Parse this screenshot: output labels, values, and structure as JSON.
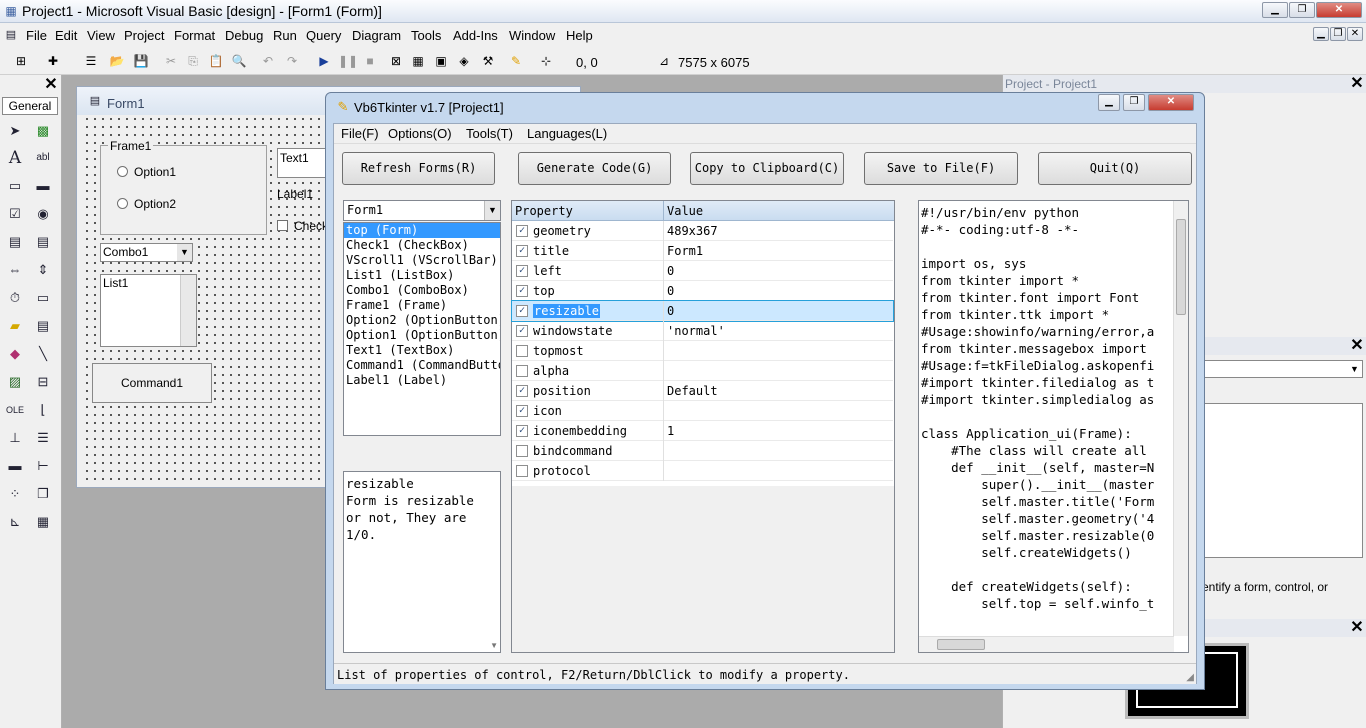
{
  "window": {
    "title": "Project1 - Microsoft Visual Basic [design] - [Form1 (Form)]"
  },
  "menu": [
    "File",
    "Edit",
    "View",
    "Project",
    "Format",
    "Debug",
    "Run",
    "Query",
    "Diagram",
    "Tools",
    "Add-Ins",
    "Window",
    "Help"
  ],
  "toolbar": {
    "position": "0, 0",
    "size": "7575 x 6075"
  },
  "toolbox": {
    "tab_label": "General",
    "close": "x"
  },
  "form_designer": {
    "title": "Form1",
    "frame_label": "Frame1",
    "option1": "Option1",
    "option2": "Option2",
    "text1": "Text1",
    "label1": "Label1",
    "check_partial": "Check",
    "combo1": "Combo1",
    "list1": "List1",
    "command1": "Command1"
  },
  "project_panel": {
    "title": "Project - Project1",
    "hint_text": "entify a form, control, or"
  },
  "vb6tkinter": {
    "title": "Vb6Tkinter v1.7 [Project1]",
    "menu": [
      "File(F)",
      "Options(O)",
      "Tools(T)",
      "Languages(L)"
    ],
    "buttons": [
      {
        "label": "Refresh Forms(R)"
      },
      {
        "label": "Generate Code(G)"
      },
      {
        "label": "Copy to Clipboard(C)"
      },
      {
        "label": "Save to File(F)"
      },
      {
        "label": "Quit(Q)"
      }
    ],
    "form_select": "Form1",
    "controls": [
      "top (Form)",
      "Check1 (CheckBox)",
      "VScroll1 (VScrollBar)",
      "List1 (ListBox)",
      "Combo1 (ComboBox)",
      "Frame1 (Frame)",
      "Option2 (OptionButton)",
      "Option1 (OptionButton)",
      "Text1 (TextBox)",
      "Command1 (CommandButto",
      "Label1 (Label)"
    ],
    "selected_control": "top (Form)",
    "description_lines": [
      "resizable",
      "Form is resizable",
      "or not, They are",
      "1/0."
    ],
    "prop_header": {
      "property": "Property",
      "value": "Value"
    },
    "properties": [
      {
        "name": "geometry",
        "value": "489x367",
        "checked": true
      },
      {
        "name": "title",
        "value": "Form1",
        "checked": true
      },
      {
        "name": "left",
        "value": "0",
        "checked": true
      },
      {
        "name": "top",
        "value": "0",
        "checked": true
      },
      {
        "name": "resizable",
        "value": "0",
        "checked": true,
        "selected": true
      },
      {
        "name": "windowstate",
        "value": "'normal'",
        "checked": true
      },
      {
        "name": "topmost",
        "value": "",
        "checked": false
      },
      {
        "name": "alpha",
        "value": "",
        "checked": false
      },
      {
        "name": "position",
        "value": "Default",
        "checked": true
      },
      {
        "name": "icon",
        "value": "",
        "checked": true
      },
      {
        "name": "iconembedding",
        "value": "1",
        "checked": true
      },
      {
        "name": "bindcommand",
        "value": "",
        "checked": false
      },
      {
        "name": "protocol",
        "value": "",
        "checked": false
      }
    ],
    "code_lines": [
      "#!/usr/bin/env python",
      "#-*- coding:utf-8 -*-",
      "",
      "import os, sys",
      "from tkinter import *",
      "from tkinter.font import Font",
      "from tkinter.ttk import *",
      "#Usage:showinfo/warning/error,a",
      "from tkinter.messagebox import ",
      "#Usage:f=tkFileDialog.askopenfi",
      "#import tkinter.filedialog as t",
      "#import tkinter.simpledialog as",
      "",
      "class Application_ui(Frame):",
      "    #The class will create all ",
      "    def __init__(self, master=N",
      "        super().__init__(master",
      "        self.master.title('Form",
      "        self.master.geometry('4",
      "        self.master.resizable(0",
      "        self.createWidgets()",
      "",
      "    def createWidgets(self):",
      "        self.top = self.winfo_t"
    ],
    "status": "List of properties of control, F2/Return/DblClick to modify a property."
  },
  "colors": {
    "selection": "#3399ff",
    "prop_selected": "#cce8ff",
    "titlebar_x": "#c9463d"
  }
}
